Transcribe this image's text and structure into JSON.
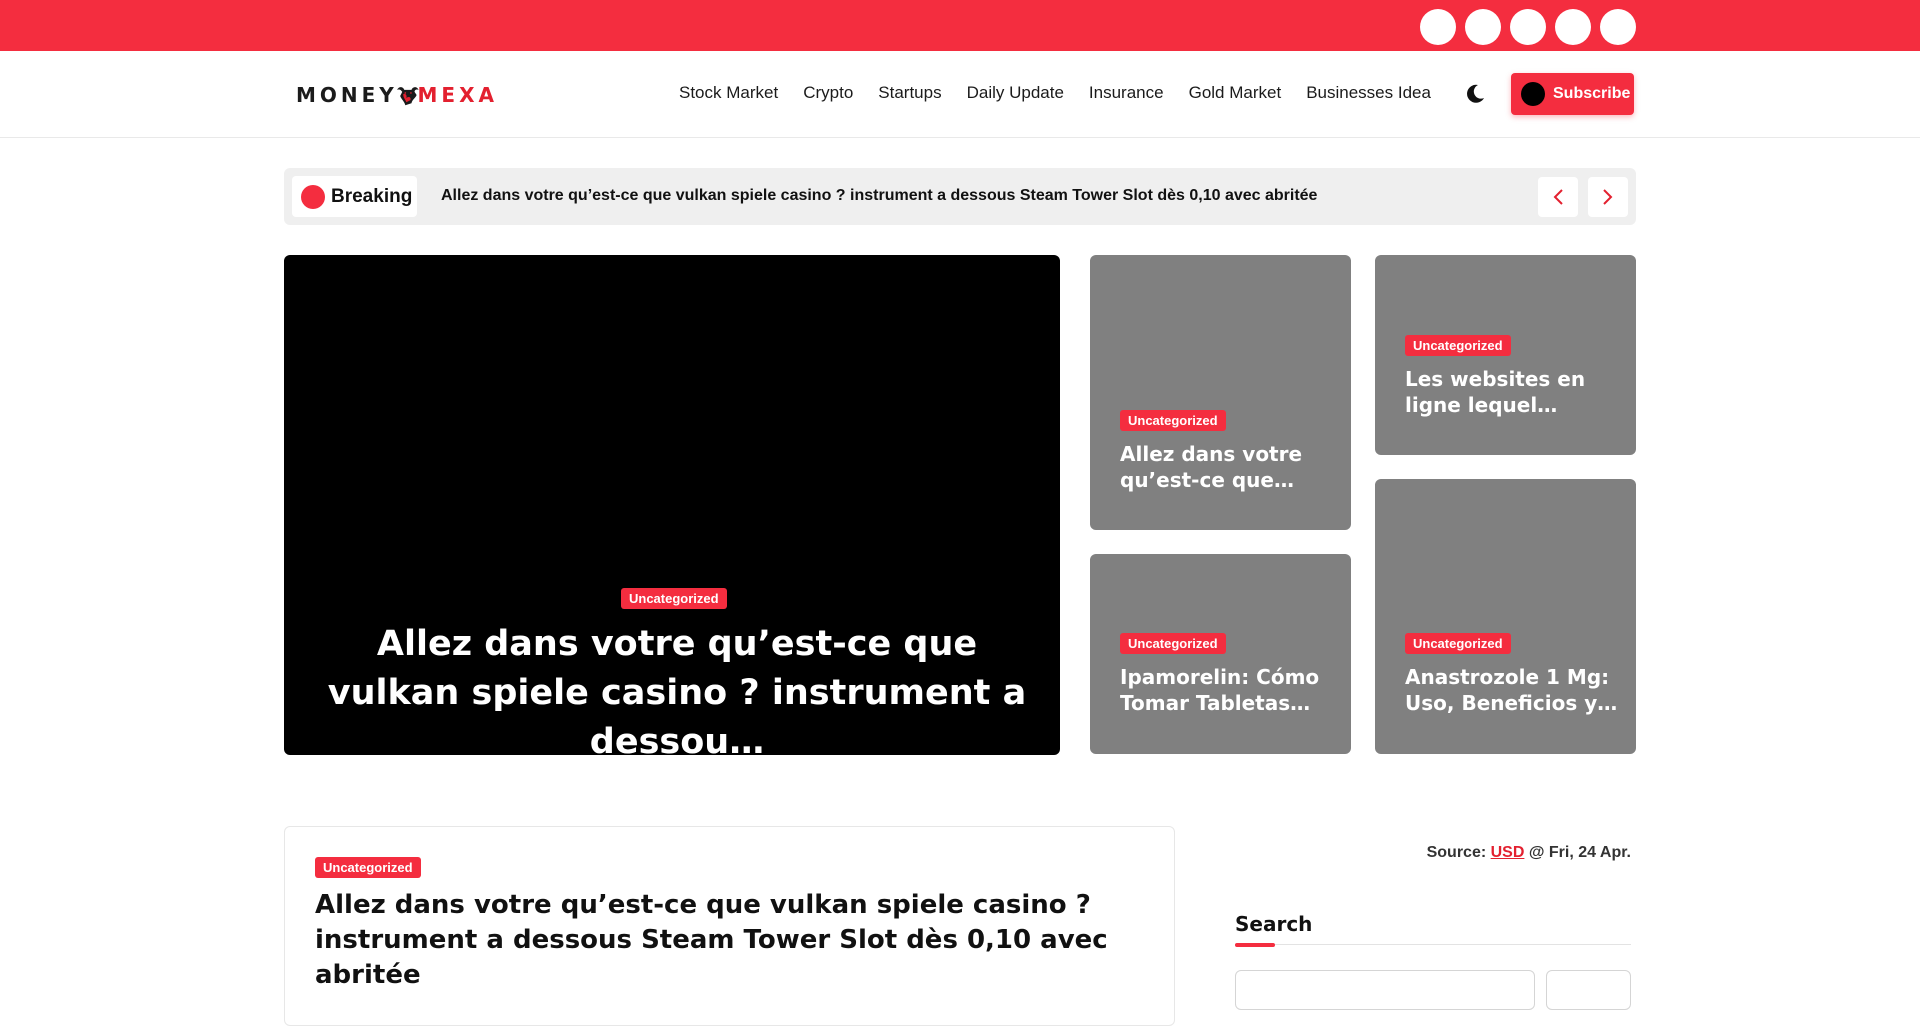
{
  "topbar": {
    "socials": [
      "social-icon-1",
      "social-icon-2",
      "social-icon-3",
      "social-icon-4",
      "social-icon-5"
    ],
    "color": "#f42d3f"
  },
  "header": {
    "logo": {
      "part1": "MONEY",
      "part2": "MEXA"
    },
    "nav": [
      "Stock Market",
      "Crypto",
      "Startups",
      "Daily Update",
      "Insurance",
      "Gold Market",
      "Businesses Idea"
    ],
    "theme_toggle_icon": "moon-icon",
    "subscribe_label": "Subscribe"
  },
  "breaking": {
    "label": "Breaking",
    "headline": "Allez dans votre qu’est-ce que vulkan spiele casino ? instrument a dessous Steam Tower Slot dès 0,10 avec abritée"
  },
  "featured": {
    "main": {
      "category": "Uncategorized",
      "title": "Allez dans votre qu’est-ce que vulkan spiele casino ? instrument a dessou…"
    },
    "cards": [
      {
        "category": "Uncategorized",
        "title": "Allez dans votre qu’est-ce que…"
      },
      {
        "category": "Uncategorized",
        "title": "Les websites en ligne lequel…"
      },
      {
        "category": "Uncategorized",
        "title": "Ipamorelin: Cómo Tomar Tabletas…"
      },
      {
        "category": "Uncategorized",
        "title": "Anastrozole 1 Mg: Uso, Beneficios y…"
      }
    ]
  },
  "post": {
    "category": "Uncategorized",
    "title": "Allez dans votre qu’est-ce que vulkan spiele casino ? instrument a dessous Steam Tower Slot dès 0,10 avec abritée"
  },
  "sidebar": {
    "source_prefix": "Source: ",
    "source_currency": "USD",
    "source_suffix": " @ Fri, 24 Apr.",
    "search_title": "Search",
    "search_placeholder": ""
  },
  "colors": {
    "accent": "#f42d3f",
    "card_bg": "#808080",
    "hero_bg": "#000000"
  }
}
